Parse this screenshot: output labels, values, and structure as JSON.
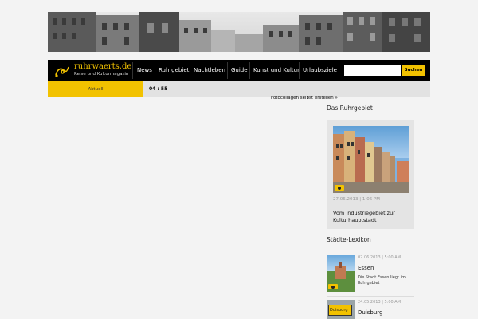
{
  "site": {
    "logo_title": "ruhrwaerts.de",
    "logo_subtitle": "Reise und Kulturmagazin"
  },
  "nav": {
    "items": [
      "News",
      "Ruhrgebiet",
      "Nachtleben",
      "Guide",
      "Kunst und Kultur",
      "Urlaubsziele"
    ],
    "search_placeholder": "",
    "search_button": "Suchen"
  },
  "subbar": {
    "tab_label": "Aktuell",
    "clock": "04 : 55",
    "ticker": "Fotocollagen selbst erstellen »"
  },
  "sidebar": {
    "ruhrgebiet": {
      "heading": "Das Ruhrgebiet",
      "date": "27.06.2013 | 1:06 PM",
      "title": "Vom Industriegebiet zur Kulturhauptstadt"
    },
    "lexikon": {
      "heading": "Städte-Lexikon",
      "items": [
        {
          "date": "02.06.2013 | 5:00 AM",
          "title": "Essen",
          "text": "Die Stadt Essen liegt im Ruhrgebiet"
        },
        {
          "date": "24.05.2013 | 5:00 AM",
          "title": "Duisburg",
          "text": ""
        }
      ]
    }
  },
  "colors": {
    "accent": "#f2c200",
    "nav_bg": "#000000",
    "page_bg": "#f3f3f3"
  },
  "icons": [
    "logo-ornament-icon",
    "camera-icon"
  ]
}
